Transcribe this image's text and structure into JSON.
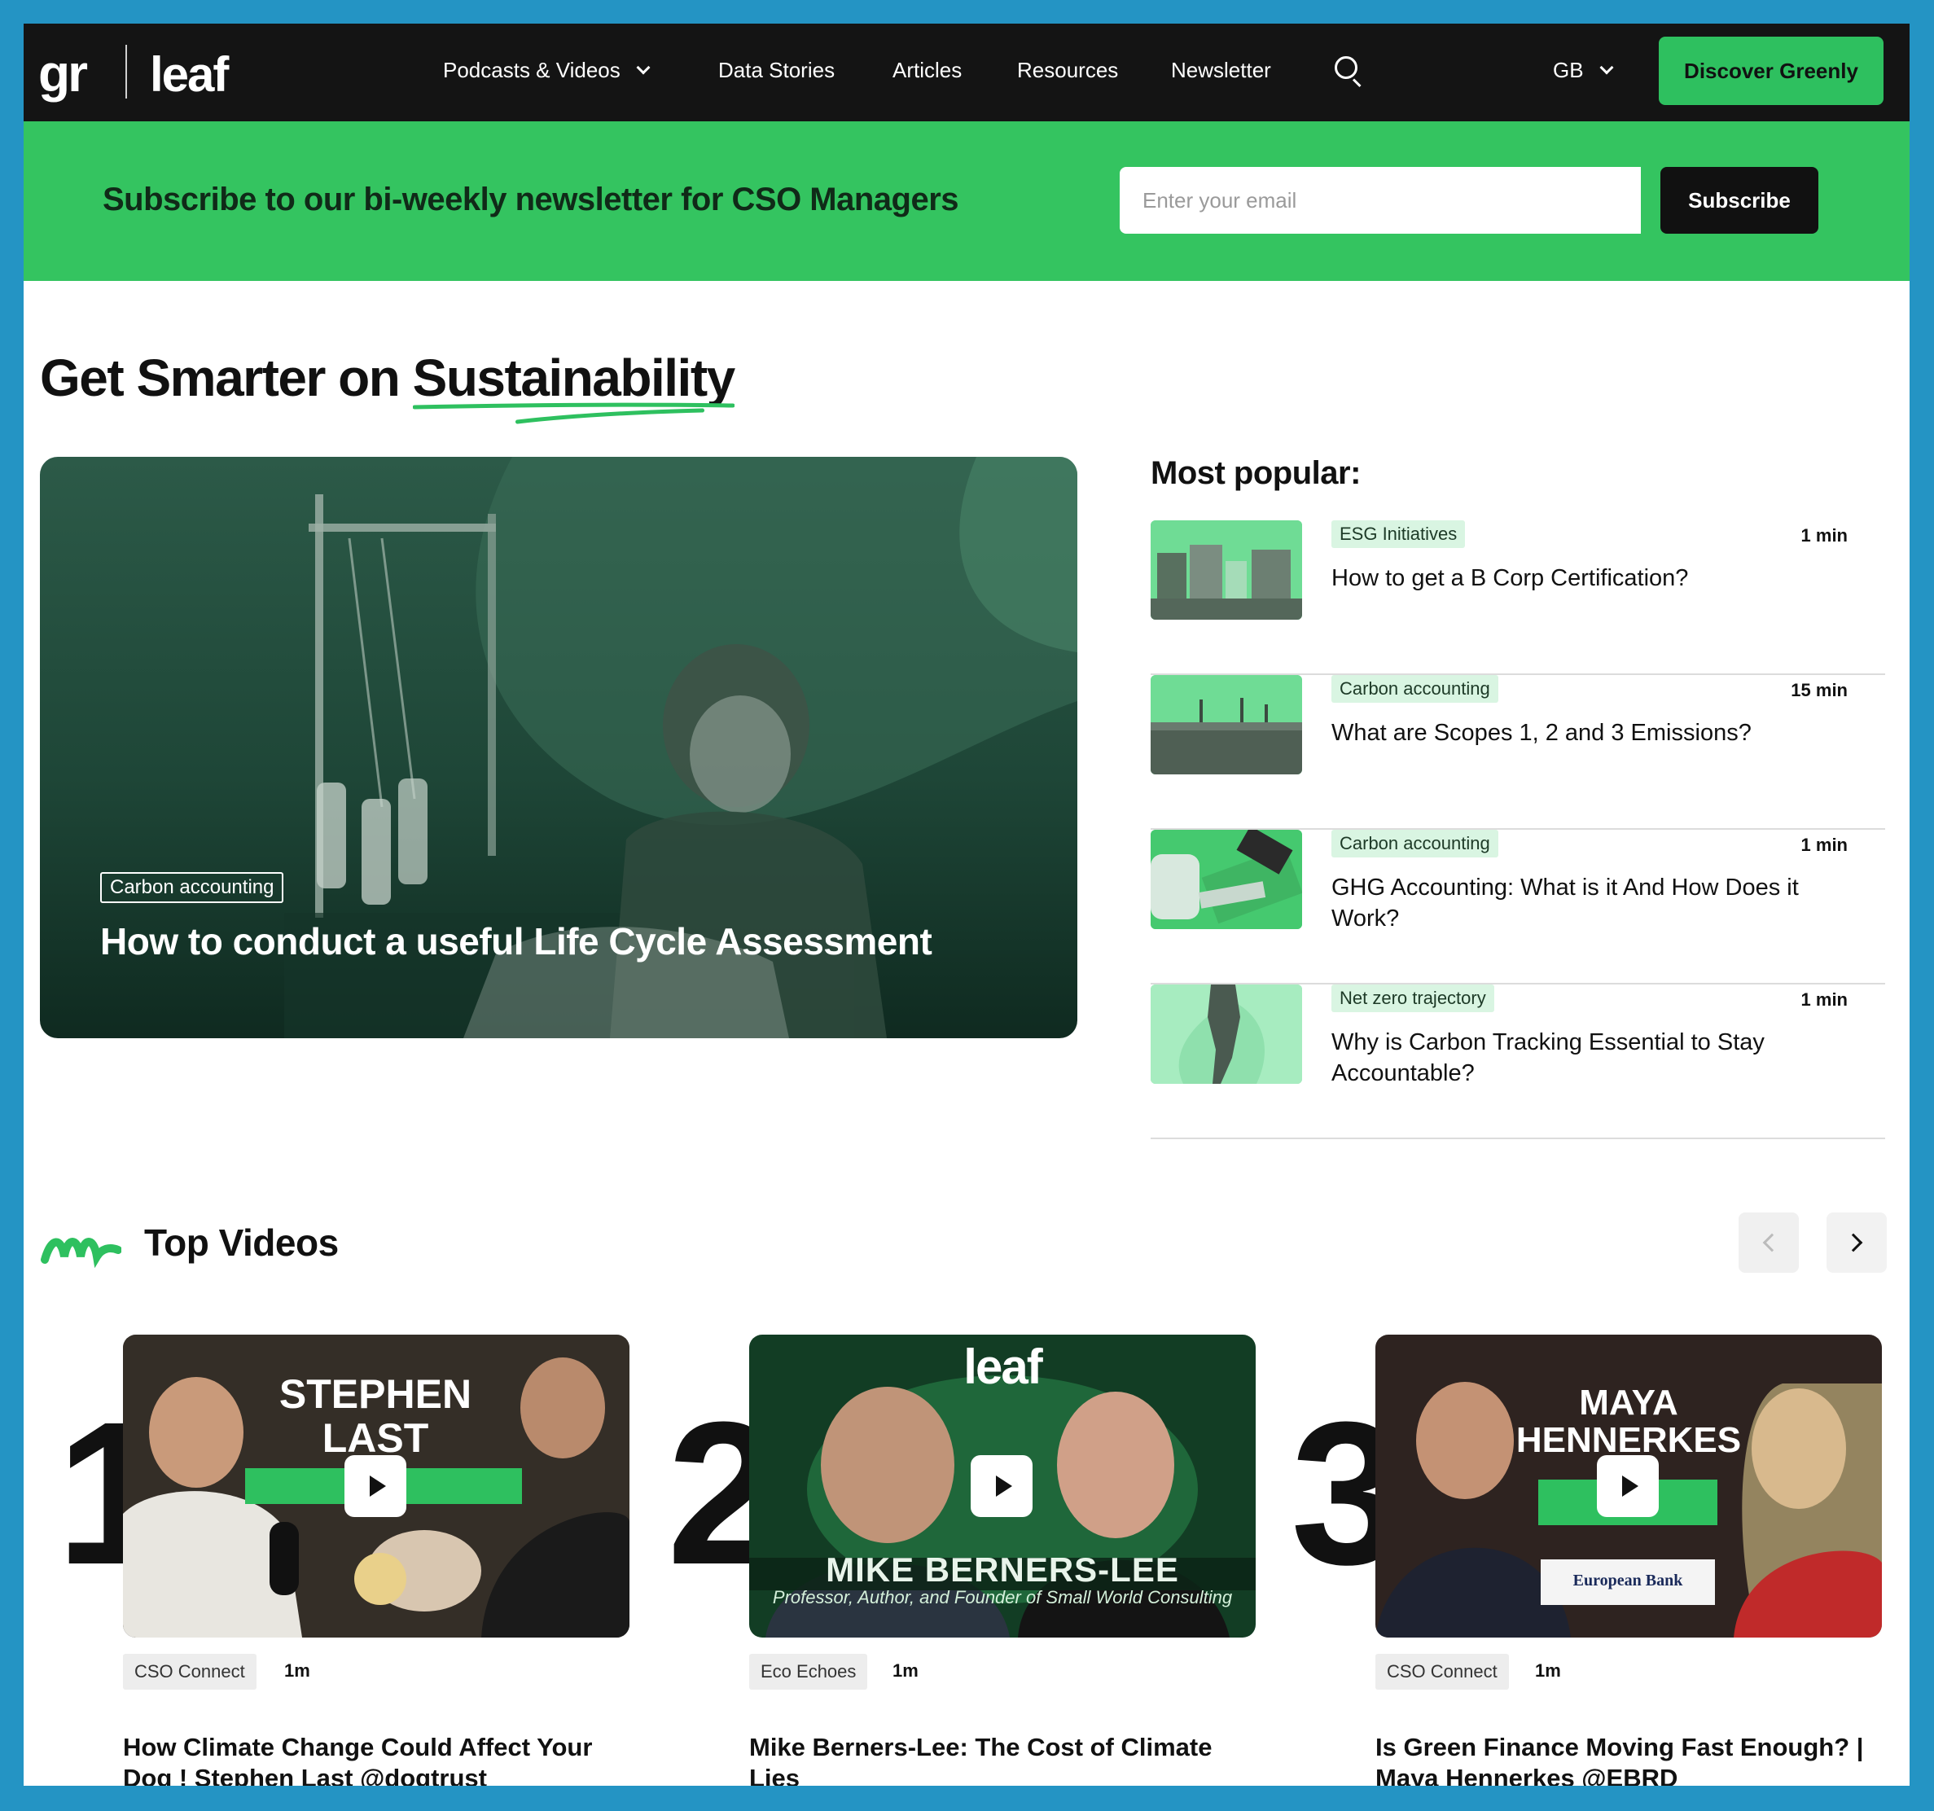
{
  "nav": {
    "logo_gr": "gr",
    "logo_leaf": "leaf",
    "items": [
      "Podcasts & Videos",
      "Data Stories",
      "Articles",
      "Resources",
      "Newsletter"
    ],
    "region": "GB",
    "cta": "Discover Greenly"
  },
  "newsletter": {
    "text": "Subscribe to our bi-weekly newsletter for CSO Managers",
    "placeholder": "Enter your email",
    "button": "Subscribe"
  },
  "hero": {
    "title_prefix": "Get Smarter on",
    "title_highlight": "Sustainability",
    "feature": {
      "tag": "Carbon accounting",
      "title": "How to conduct a useful Life Cycle Assessment"
    }
  },
  "most_popular": {
    "title": "Most popular:",
    "items": [
      {
        "tag": "ESG Initiatives",
        "time": "1 min",
        "title": "How to get a B Corp Certification?"
      },
      {
        "tag": "Carbon accounting",
        "time": "15 min",
        "title": "What are Scopes 1, 2 and 3 Emissions?"
      },
      {
        "tag": "Carbon accounting",
        "time": "1 min",
        "title": "GHG Accounting: What is it And How Does it Work?"
      },
      {
        "tag": "Net zero trajectory",
        "time": "1 min",
        "title": "Why is Carbon Tracking Essential to Stay Accountable?"
      }
    ]
  },
  "top_videos": {
    "title": "Top Videos",
    "videos": [
      {
        "rank": "1",
        "thumb_name_1": "STEPHEN",
        "thumb_name_2": "LAST",
        "tag": "CSO Connect",
        "time": "1m",
        "title": "How Climate Change Could Affect Your Dog ! Stephen Last @dogtrust"
      },
      {
        "rank": "2",
        "thumb_logo": "leaf",
        "thumb_name_1": "MIKE BERNERS-LEE",
        "thumb_sub": "Professor, Author, and Founder of Small World Consulting",
        "tag": "Eco Echoes",
        "time": "1m",
        "title": "Mike Berners-Lee: The Cost of Climate Lies"
      },
      {
        "rank": "3",
        "thumb_name_1": "MAYA",
        "thumb_name_2": "HENNERKES",
        "thumb_bank": "European Bank",
        "tag": "CSO Connect",
        "time": "1m",
        "title": "Is Green Finance Moving Fast Enough? | Maya Hennerkes @EBRD"
      }
    ]
  },
  "colors": {
    "brand_green": "#34c460",
    "dark": "#141414",
    "frame": "#2494c4"
  }
}
